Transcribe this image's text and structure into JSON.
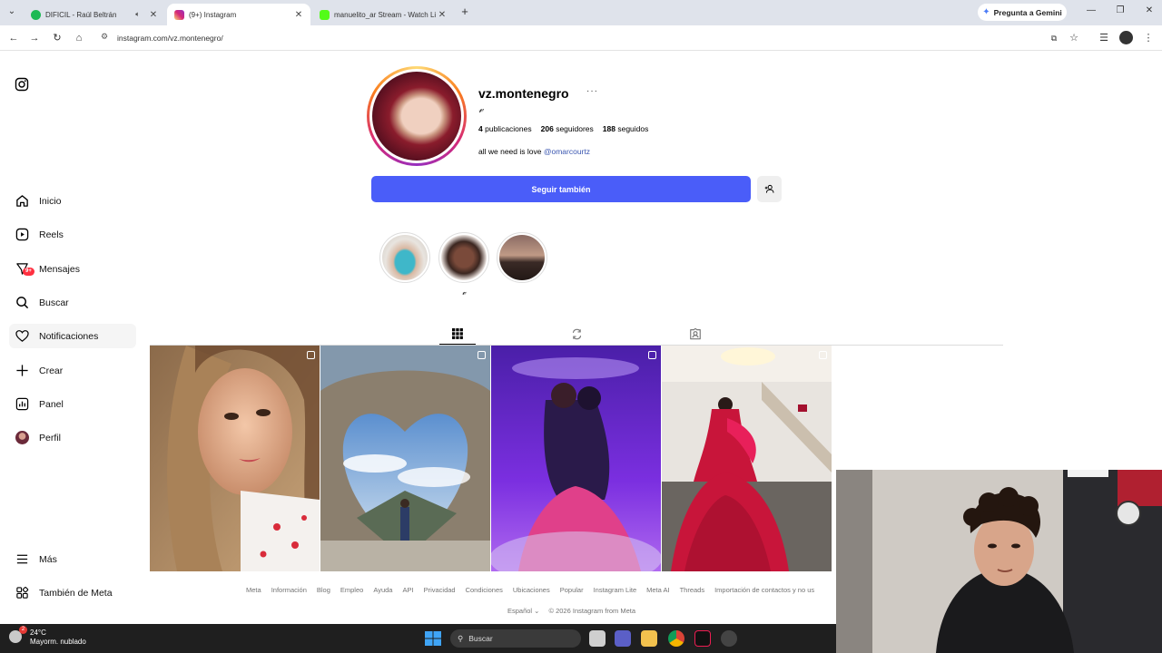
{
  "browser": {
    "tabs": [
      {
        "label": "DIFICIL - Raúl Beltrán",
        "active": false,
        "favicon_color": "#1db954"
      },
      {
        "label": "(9+) Instagram",
        "active": true,
        "favicon_color": "#d62976"
      },
      {
        "label": "manuelito_ar Stream - Watch Li",
        "active": false,
        "favicon_color": "#53fc18"
      }
    ],
    "gemini_label": "Pregunta a Gemini",
    "url": "instagram.com/vz.montenegro/"
  },
  "sidebar": {
    "items": [
      {
        "label": "Inicio",
        "icon": "home-icon"
      },
      {
        "label": "Reels",
        "icon": "reels-icon"
      },
      {
        "label": "Mensajes",
        "icon": "messages-icon",
        "badge": "9+"
      },
      {
        "label": "Buscar",
        "icon": "search-icon"
      },
      {
        "label": "Notificaciones",
        "icon": "heart-icon"
      },
      {
        "label": "Crear",
        "icon": "plus-icon"
      },
      {
        "label": "Panel",
        "icon": "chart-icon"
      },
      {
        "label": "Perfil",
        "icon": "avatar"
      }
    ],
    "more_label": "Más",
    "meta_label": "También de Meta"
  },
  "profile": {
    "username": "vz.montenegro",
    "more": "···",
    "full_name": "𝓋",
    "posts_count": "4",
    "posts_label": "publicaciones",
    "followers_count": "206",
    "followers_label": "seguidores",
    "following_count": "188",
    "following_label": "seguidos",
    "bio_text": "all we need is love",
    "bio_mention": "@omarcourtz",
    "follow_button": "Seguir también"
  },
  "highlights": [
    {
      "label": ""
    },
    {
      "label": "𝓋"
    },
    {
      "label": ""
    }
  ],
  "footer": {
    "links": [
      "Meta",
      "Información",
      "Blog",
      "Empleo",
      "Ayuda",
      "API",
      "Privacidad",
      "Condiciones",
      "Ubicaciones",
      "Popular",
      "Instagram Lite",
      "Meta AI",
      "Threads",
      "Importación de contactos y no us"
    ],
    "language": "Español ⌄",
    "copyright": "© 2026 Instagram from Meta"
  },
  "taskbar": {
    "temperature": "24°C",
    "weather": "Mayorm. nublado",
    "weather_badge": "2",
    "search_label": "Buscar"
  }
}
